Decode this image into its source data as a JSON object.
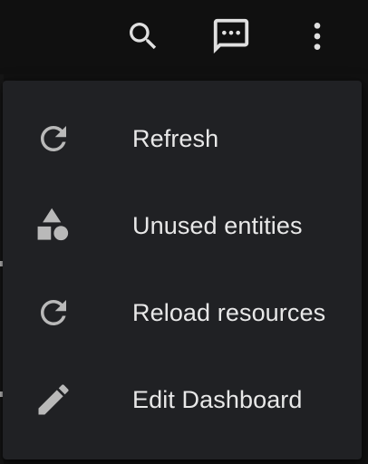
{
  "toolbar": {
    "icons": [
      "search-icon",
      "chat-message-icon",
      "more-vertical-icon"
    ]
  },
  "menu": {
    "items": [
      {
        "label": "Refresh",
        "icon": "refresh-icon"
      },
      {
        "label": "Unused entities",
        "icon": "shapes-icon"
      },
      {
        "label": "Reload resources",
        "icon": "refresh-icon"
      },
      {
        "label": "Edit Dashboard",
        "icon": "pencil-icon"
      }
    ]
  },
  "colors": {
    "background": "#111111",
    "menu_surface": "#202124",
    "icon": "#b9b9b9",
    "text": "#e8e8e8"
  }
}
